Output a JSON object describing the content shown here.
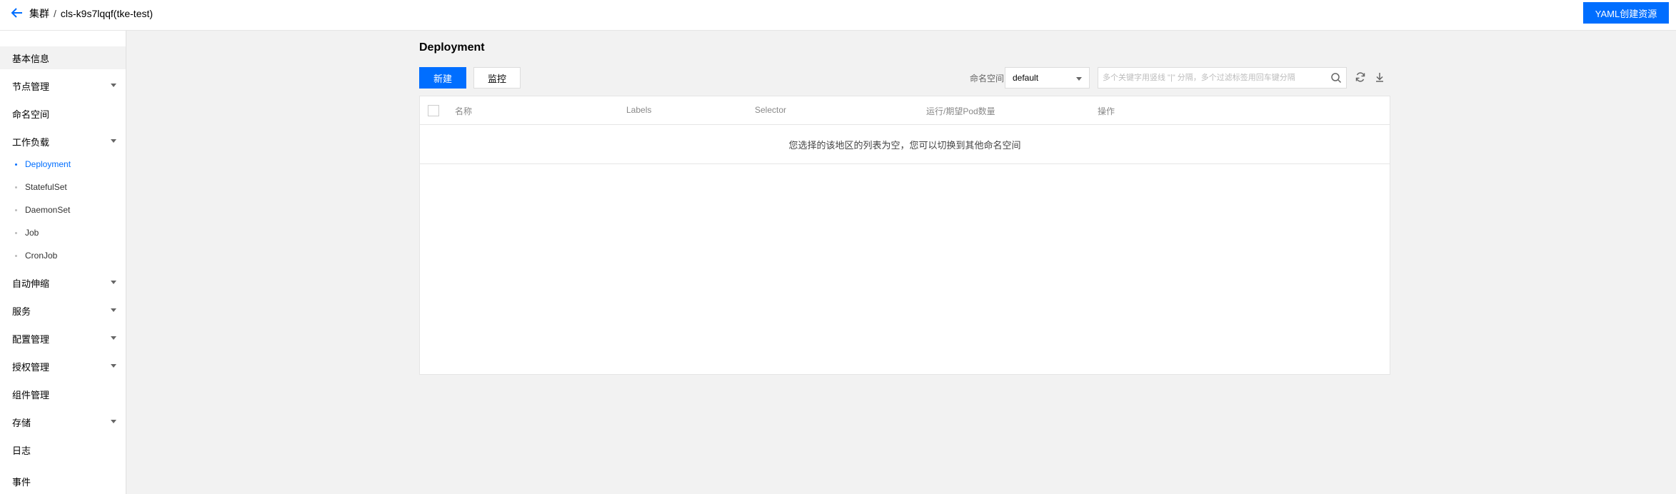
{
  "header": {
    "breadcrumb_root": "集群",
    "breadcrumb_sep": "/",
    "cluster_name": "cls-k9s7lqqf(tke-test)",
    "yaml_button": "YAML创建资源"
  },
  "sidebar": {
    "items": [
      {
        "label": "基本信息"
      },
      {
        "label": "节点管理"
      },
      {
        "label": "命名空间"
      },
      {
        "label": "工作负载"
      },
      {
        "label": "自动伸缩"
      },
      {
        "label": "服务"
      },
      {
        "label": "配置管理"
      },
      {
        "label": "授权管理"
      },
      {
        "label": "组件管理"
      },
      {
        "label": "存储"
      },
      {
        "label": "日志"
      },
      {
        "label": "事件"
      }
    ],
    "workload_sub": [
      {
        "label": "Deployment"
      },
      {
        "label": "StatefulSet"
      },
      {
        "label": "DaemonSet"
      },
      {
        "label": "Job"
      },
      {
        "label": "CronJob"
      }
    ]
  },
  "main": {
    "title": "Deployment",
    "create_button": "新建",
    "monitor_button": "监控",
    "namespace_label": "命名空间",
    "namespace_value": "default",
    "search_placeholder": "多个关键字用竖线 \"|\" 分隔，多个过滤标签用回车键分隔",
    "table": {
      "columns": [
        "名称",
        "Labels",
        "Selector",
        "运行/期望Pod数量",
        "操作"
      ],
      "empty_message": "您选择的该地区的列表为空，您可以切换到其他命名空间"
    }
  },
  "colors": {
    "accent": "#006eff",
    "background": "#f2f2f2"
  },
  "icons": {
    "back": "arrow-left-icon",
    "search": "search-icon",
    "refresh": "refresh-icon",
    "download": "download-icon",
    "caret": "chevron-down-icon"
  }
}
